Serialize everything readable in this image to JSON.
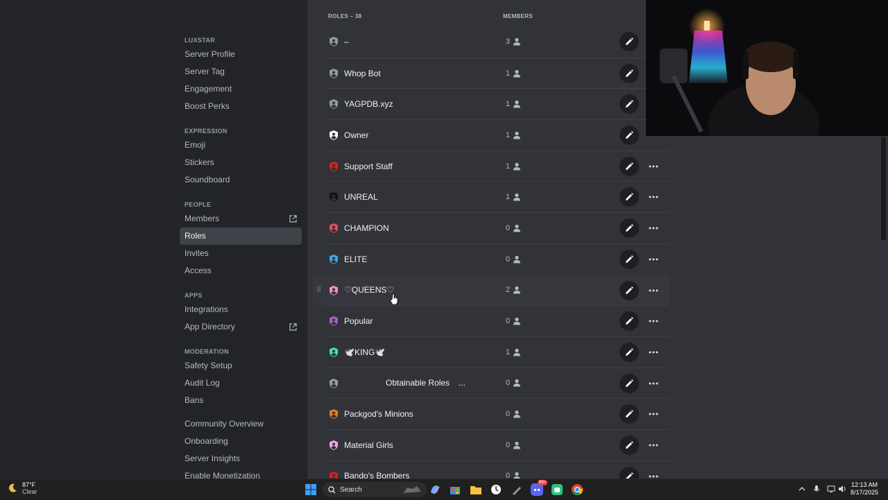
{
  "sidebar": {
    "sections": [
      {
        "title": "LUXSTAR",
        "items": [
          {
            "label": "Server Profile"
          },
          {
            "label": "Server Tag"
          },
          {
            "label": "Engagement"
          },
          {
            "label": "Boost Perks"
          }
        ]
      },
      {
        "title": "EXPRESSION",
        "items": [
          {
            "label": "Emoji"
          },
          {
            "label": "Stickers"
          },
          {
            "label": "Soundboard"
          }
        ]
      },
      {
        "title": "PEOPLE",
        "items": [
          {
            "label": "Members",
            "external": true
          },
          {
            "label": "Roles",
            "active": true
          },
          {
            "label": "Invites"
          },
          {
            "label": "Access"
          }
        ]
      },
      {
        "title": "APPS",
        "items": [
          {
            "label": "Integrations"
          },
          {
            "label": "App Directory",
            "external": true
          }
        ]
      },
      {
        "title": "MODERATION",
        "items": [
          {
            "label": "Safety Setup"
          },
          {
            "label": "Audit Log"
          },
          {
            "label": "Bans"
          }
        ]
      },
      {
        "title": "",
        "items": [
          {
            "label": "Community Overview"
          },
          {
            "label": "Onboarding"
          },
          {
            "label": "Server Insights"
          },
          {
            "label": "Enable Monetization"
          }
        ]
      }
    ]
  },
  "roles_header": {
    "roles": "ROLES – 38",
    "members": "MEMBERS"
  },
  "roles": [
    {
      "name": "–",
      "count": "3",
      "color": "#949ba4",
      "more": false
    },
    {
      "name": "Whop Bot",
      "count": "1",
      "color": "#949ba4",
      "more": false
    },
    {
      "name": "YAGPDB.xyz",
      "count": "1",
      "color": "#949ba4",
      "more": false
    },
    {
      "name": "Owner",
      "count": "1",
      "color": "#ffffff",
      "more": false
    },
    {
      "name": "Support Staff",
      "count": "1",
      "color": "#e01e1e",
      "more": true
    },
    {
      "name": "UNREAL",
      "count": "1",
      "color": "#111214",
      "more": true
    },
    {
      "name": "CHAMPION",
      "count": "0",
      "color": "#e74c5a",
      "more": true
    },
    {
      "name": "ELITE",
      "count": "0",
      "color": "#3ba7e6",
      "more": true
    },
    {
      "name": "♡QUEENS♡",
      "count": "2",
      "color": "#f28fc8",
      "more": true,
      "hover": true
    },
    {
      "name": "Popular",
      "count": "0",
      "color": "#a55fd6",
      "more": true
    },
    {
      "name": "🕊️KING🕊️",
      "count": "1",
      "color": "#3ee6b0",
      "more": true
    },
    {
      "name": "Obtainable Roles",
      "suffix": "...",
      "count": "0",
      "color": "#949ba4",
      "more": true,
      "centered": true
    },
    {
      "name": "Packgod's Minions",
      "count": "0",
      "color": "#e67e22",
      "more": true
    },
    {
      "name": "Material Girls",
      "count": "0",
      "color": "#f7a1e6",
      "more": true
    },
    {
      "name": "Bando's Bombers",
      "count": "0",
      "color": "#e01e1e",
      "more": true
    }
  ],
  "taskbar": {
    "temperature": "87°F",
    "condition": "Clear",
    "search_label": "Search",
    "time": "12:13 AM",
    "date": "8/17/2025",
    "discord_badge": "99+"
  }
}
